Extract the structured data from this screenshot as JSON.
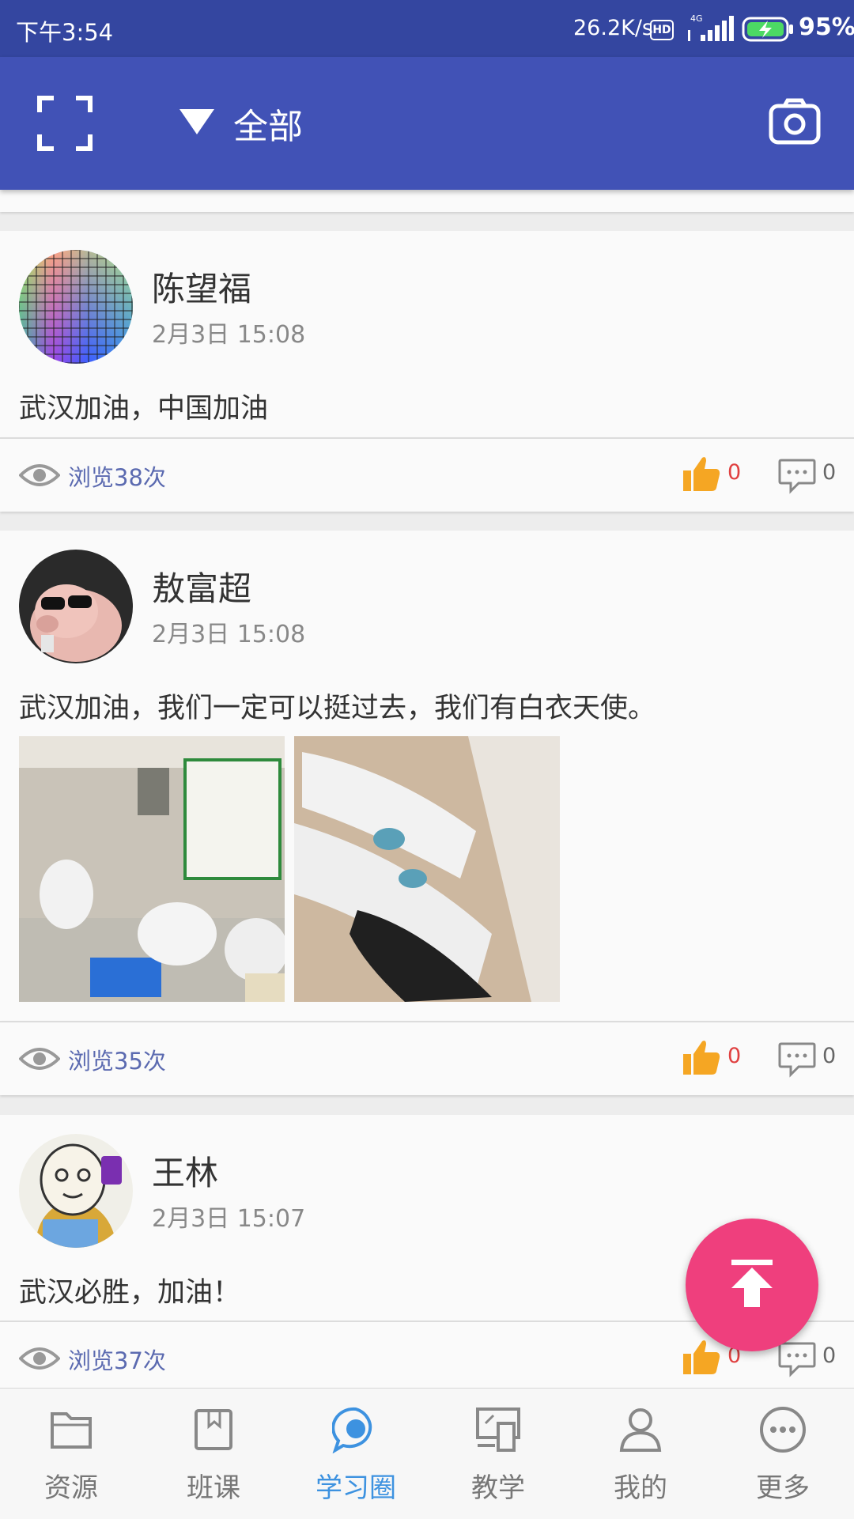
{
  "status_bar": {
    "time": "下午3:54",
    "network_speed": "26.2K/s",
    "hd_badge": "HD",
    "network_type": "4G",
    "battery_percent": "95%"
  },
  "app_bar": {
    "filter_label": "全部",
    "icons": [
      "scan-icon",
      "dropdown-triangle-icon",
      "camera-icon"
    ]
  },
  "posts": [
    {
      "author": "陈望福",
      "time": "2月3日  15:08",
      "content": "武汉加油，中国加油",
      "views": "浏览38次",
      "likes": "0",
      "comments": "0",
      "photos": []
    },
    {
      "author": "敖富超",
      "time": "2月3日  15:08",
      "content": "武汉加油，我们一定可以挺过去，我们有白衣天使。",
      "views": "浏览35次",
      "likes": "0",
      "comments": "0",
      "photos": [
        "photo-medics-resting-chairs",
        "photo-medics-sleeping-floor"
      ]
    },
    {
      "author": "王林",
      "time": "2月3日  15:07",
      "content": "武汉必胜，加油！",
      "views": "浏览37次",
      "likes": "0",
      "comments": "0",
      "photos": []
    }
  ],
  "bottom_nav": [
    {
      "label": "资源",
      "icon": "folder-icon",
      "active": false
    },
    {
      "label": "班课",
      "icon": "book-icon",
      "active": false
    },
    {
      "label": "学习圈",
      "icon": "chat-bubble-icon",
      "active": true
    },
    {
      "label": "教学",
      "icon": "devices-icon",
      "active": false
    },
    {
      "label": "我的",
      "icon": "person-icon",
      "active": false
    },
    {
      "label": "更多",
      "icon": "more-icon",
      "active": false
    }
  ],
  "colors": {
    "status_bar": "#3446a0",
    "app_bar": "#4152b6",
    "active_tab": "#3d92e0",
    "fab": "#ef3f7d",
    "like_icon": "#f5a623",
    "like_count": "#e04040",
    "views_text": "#5b6ab0"
  }
}
